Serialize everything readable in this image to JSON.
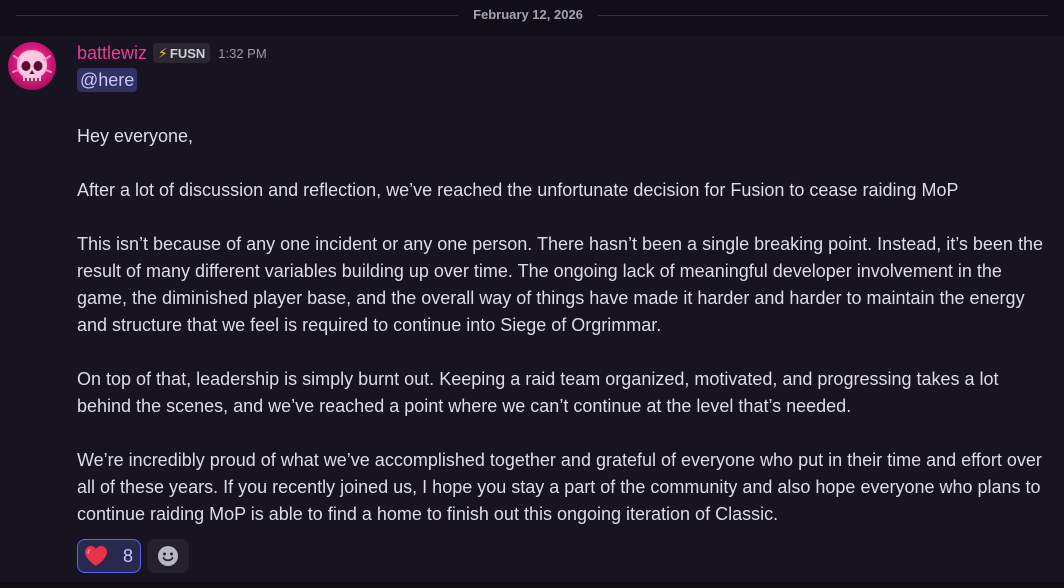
{
  "divider": {
    "date": "February 12, 2026"
  },
  "message": {
    "author": "battlewiz",
    "author_color": "#e83e96",
    "tag": {
      "icon": "lightning-bolt-icon",
      "label": "FUSN"
    },
    "timestamp": "1:32 PM",
    "mention": "@here",
    "paragraphs": [
      "Hey everyone,",
      "After a lot of discussion and reflection, we’ve reached the unfortunate decision for Fusion to cease raiding MoP",
      "This isn’t because of any one incident or any one person. There hasn’t been a single breaking point. Instead, it’s been the result of many different variables building up over time. The ongoing lack of meaningful developer involvement in the game, the diminished player base, and the overall way of things have made it harder and harder to maintain the energy and structure that we feel is required to continue into Siege of Orgrimmar.",
      "On top of that, leadership is simply burnt out. Keeping a raid team organized, motivated, and progressing takes a lot behind the scenes, and we’ve reached a point where we can’t continue at the level that’s needed.",
      "We’re incredibly proud of what we’ve accomplished together and grateful of everyone who put in their time and effort over all of these years. If you recently joined us, I hope you stay a part of the community and also hope everyone who plans to continue raiding MoP is able to find a home to finish out this ongoing iteration of Classic."
    ],
    "reactions": [
      {
        "icon": "heart-icon",
        "count": "8"
      }
    ],
    "add_reaction_icon": "add-reaction-icon"
  },
  "colors": {
    "background": "#110e17",
    "message_background": "#171320",
    "mention_bg": "#303262",
    "reaction_border": "#5865f2"
  }
}
